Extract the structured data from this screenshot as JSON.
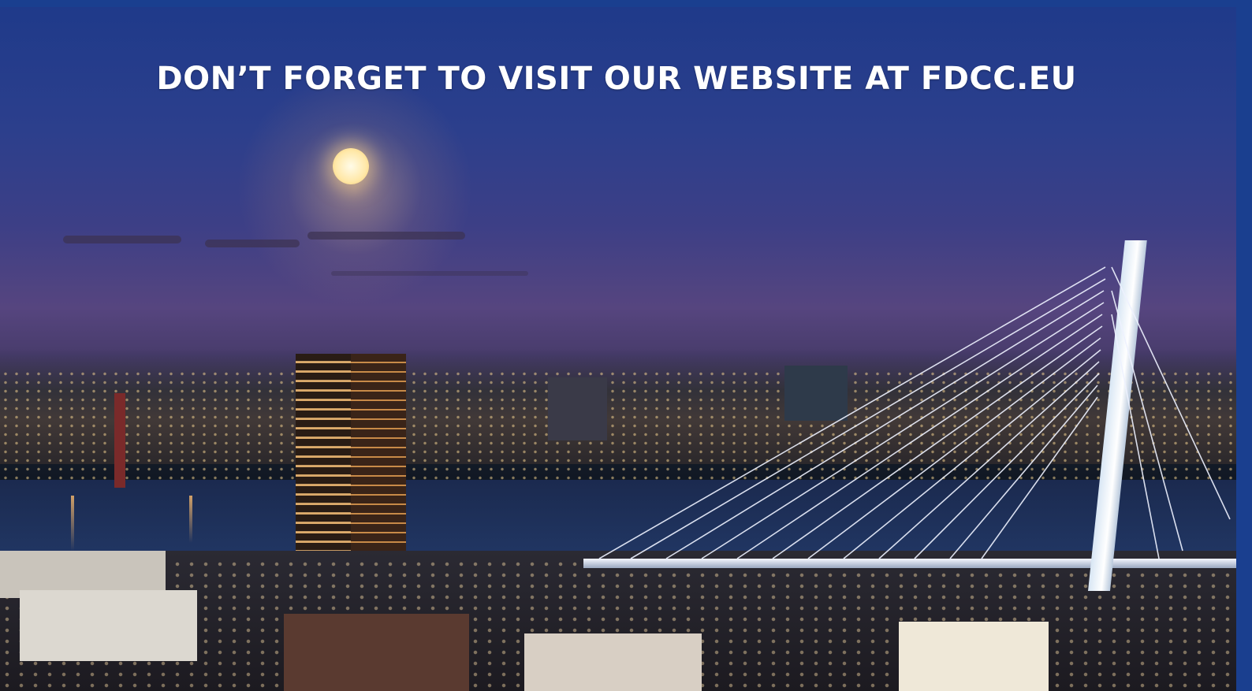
{
  "banner": {
    "headline": "DON’T FORGET TO VISIT OUR WEBSITE AT FDCC.EU"
  },
  "colors": {
    "frame": "#1a3f8f",
    "text": "#ffffff"
  }
}
